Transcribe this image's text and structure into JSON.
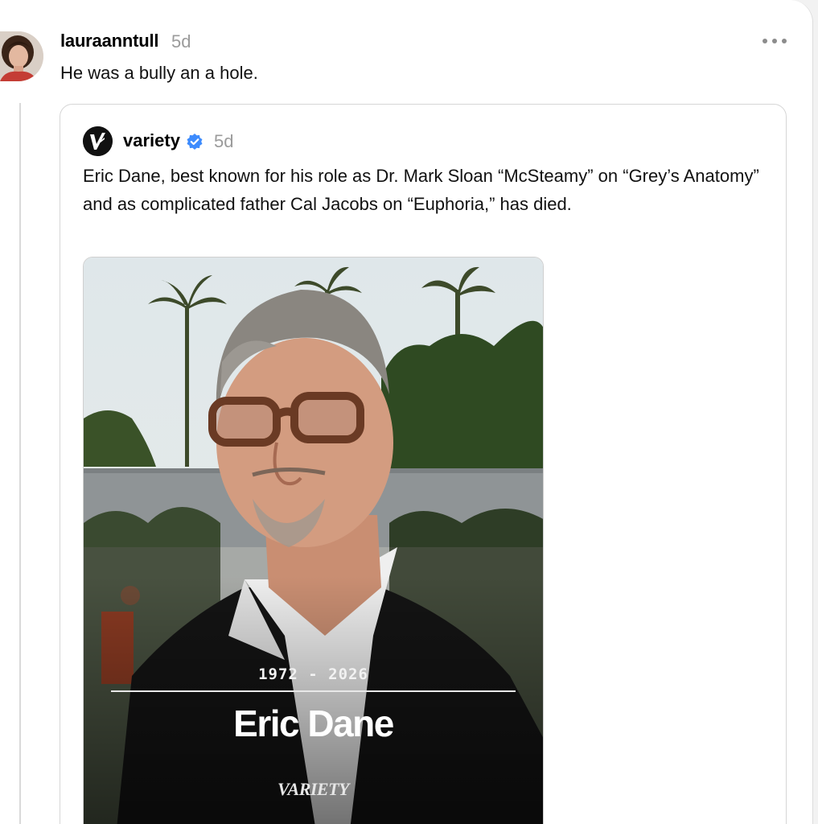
{
  "reply": {
    "username": "lauraanntull",
    "time": "5d",
    "text": "He was a bully an a hole."
  },
  "quoted_post": {
    "username": "variety",
    "time": "5d",
    "body": "Eric Dane, best known for his role as Dr. Mark Sloan “McSteamy” on “Grey’s Anatomy” and as complicated father Cal Jacobs on “Euphoria,” has died.",
    "image": {
      "years": "1972 - 2026",
      "name": "Eric Dane",
      "brand": "VARIETY"
    }
  },
  "icons": {
    "more": "more-horizontal-icon",
    "verified": "verified-badge-icon"
  },
  "colors": {
    "verified_blue": "#3d8bfd",
    "muted_text": "#9b9b9b"
  }
}
